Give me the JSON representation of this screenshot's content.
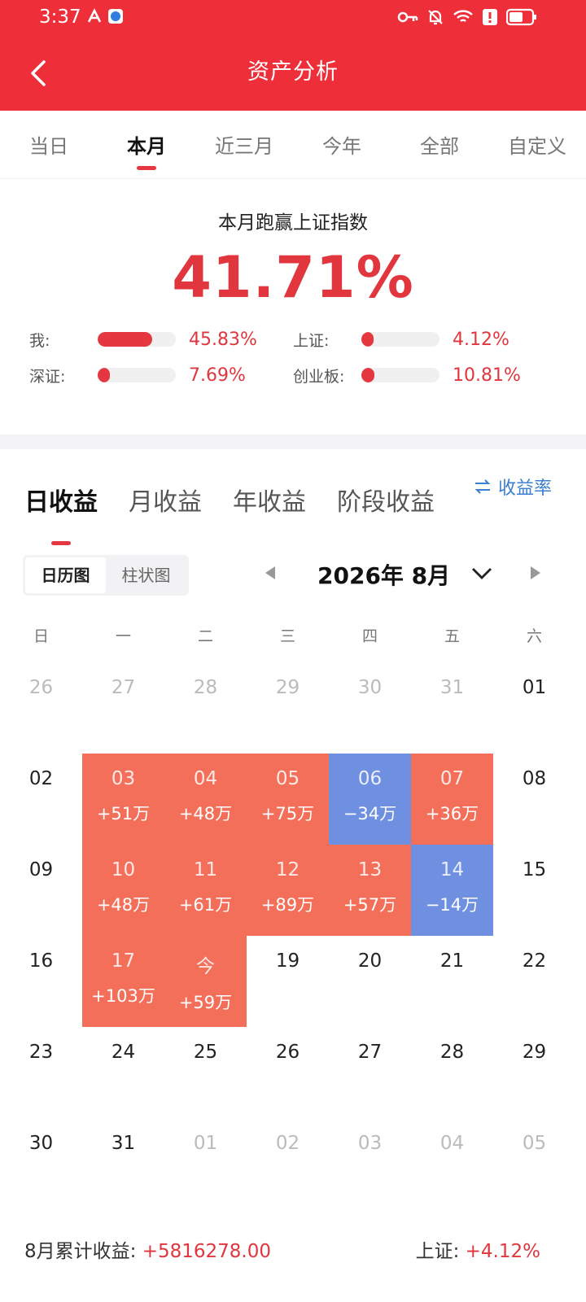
{
  "status_bar": {
    "time": "3:37"
  },
  "header": {
    "title": "资产分析"
  },
  "period_tabs": [
    {
      "label": "当日",
      "active": false
    },
    {
      "label": "本月",
      "active": true
    },
    {
      "label": "近三月",
      "active": false
    },
    {
      "label": "今年",
      "active": false
    },
    {
      "label": "全部",
      "active": false
    },
    {
      "label": "自定义",
      "active": false
    }
  ],
  "summary": {
    "subtitle": "本月跑赢上证指数",
    "value": "41.71%",
    "bars": [
      {
        "label": "我:",
        "value": "45.83%",
        "fill": 0.7
      },
      {
        "label": "上证:",
        "value": "4.12%",
        "fill": 0.07
      },
      {
        "label": "深证:",
        "value": "7.69%",
        "fill": 0.12
      },
      {
        "label": "创业板:",
        "value": "10.81%",
        "fill": 0.17
      }
    ]
  },
  "earning_tabs": [
    {
      "label": "日收益",
      "active": true
    },
    {
      "label": "月收益",
      "active": false
    },
    {
      "label": "年收益",
      "active": false
    },
    {
      "label": "阶段收益",
      "active": false
    }
  ],
  "rate_toggle": {
    "label": "收益率"
  },
  "view_toggle": {
    "calendar": "日历图",
    "bar": "柱状图"
  },
  "month_label": "2026年 8月",
  "weekdays": [
    "日",
    "一",
    "二",
    "三",
    "四",
    "五",
    "六"
  ],
  "calendar": [
    {
      "day": "26",
      "muted": true
    },
    {
      "day": "27",
      "muted": true
    },
    {
      "day": "28",
      "muted": true
    },
    {
      "day": "29",
      "muted": true
    },
    {
      "day": "30",
      "muted": true
    },
    {
      "day": "31",
      "muted": true
    },
    {
      "day": "01"
    },
    {
      "day": "02"
    },
    {
      "day": "03",
      "amount": "+51万",
      "trend": "up"
    },
    {
      "day": "04",
      "amount": "+48万",
      "trend": "up"
    },
    {
      "day": "05",
      "amount": "+75万",
      "trend": "up"
    },
    {
      "day": "06",
      "amount": "−34万",
      "trend": "down"
    },
    {
      "day": "07",
      "amount": "+36万",
      "trend": "up"
    },
    {
      "day": "08"
    },
    {
      "day": "09"
    },
    {
      "day": "10",
      "amount": "+48万",
      "trend": "up"
    },
    {
      "day": "11",
      "amount": "+61万",
      "trend": "up"
    },
    {
      "day": "12",
      "amount": "+89万",
      "trend": "up"
    },
    {
      "day": "13",
      "amount": "+57万",
      "trend": "up"
    },
    {
      "day": "14",
      "amount": "−14万",
      "trend": "down"
    },
    {
      "day": "15"
    },
    {
      "day": "16"
    },
    {
      "day": "17",
      "amount": "+103万",
      "trend": "up"
    },
    {
      "day": "今",
      "amount": "+59万",
      "trend": "up"
    },
    {
      "day": "19"
    },
    {
      "day": "20"
    },
    {
      "day": "21"
    },
    {
      "day": "22"
    },
    {
      "day": "23"
    },
    {
      "day": "24"
    },
    {
      "day": "25"
    },
    {
      "day": "26"
    },
    {
      "day": "27"
    },
    {
      "day": "28"
    },
    {
      "day": "29"
    },
    {
      "day": "30"
    },
    {
      "day": "31"
    },
    {
      "day": "01",
      "muted": true
    },
    {
      "day": "02",
      "muted": true
    },
    {
      "day": "03",
      "muted": true
    },
    {
      "day": "04",
      "muted": true
    },
    {
      "day": "05",
      "muted": true
    }
  ],
  "footer": {
    "month_total_label": "8月累计收益:",
    "month_total_value": "+5816278.00",
    "index_label": "上证:",
    "index_value": "+4.12%"
  },
  "colors": {
    "brand_red": "#ee2f3a",
    "gain": "#f46f5a",
    "loss": "#6f8fe0",
    "link_blue": "#3b7fd1"
  }
}
